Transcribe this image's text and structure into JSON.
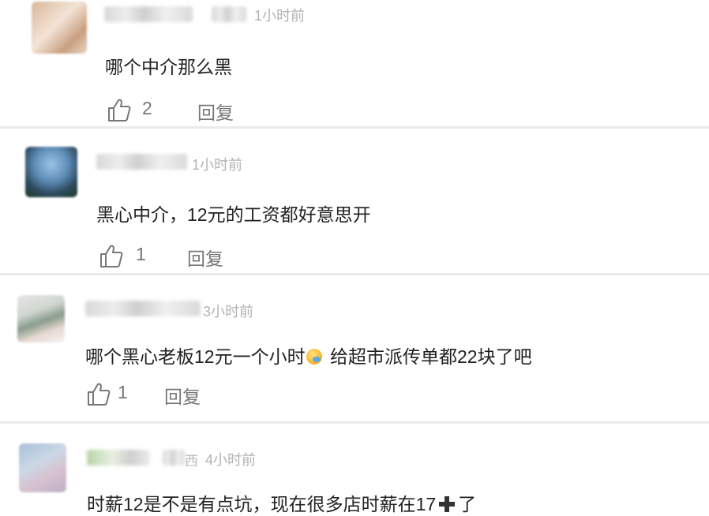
{
  "comments": [
    {
      "name_tail": "",
      "time": "1小时前",
      "text": "哪个中介那么黑",
      "likes": "2",
      "reply_label": "回复"
    },
    {
      "name_tail": "",
      "time": "1小时前",
      "text": "黑心中介，12元的工资都好意思开",
      "likes": "1",
      "reply_label": "回复"
    },
    {
      "name_tail": "",
      "time": "3小时前",
      "text_before": "哪个黑心老板12元一个小时",
      "text_after": " 给超市派传单都22块了吧",
      "likes": "1",
      "reply_label": "回复"
    },
    {
      "name_tail": "西",
      "time": "4小时前",
      "text_before": "时薪12是不是有点坑，现在很多店时薪在17",
      "text_after": "了"
    }
  ],
  "icons": {
    "like": "thumbs-up-icon",
    "emoji": "sweat-smile-emoji-icon",
    "cross": "plus-cross-icon"
  },
  "colors": {
    "text": "#222222",
    "meta": "#b3b3b3",
    "action": "#777777",
    "divider": "#eaeaea"
  }
}
